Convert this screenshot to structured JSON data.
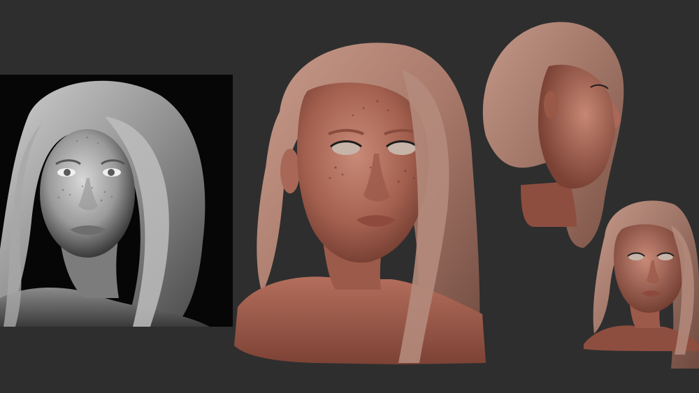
{
  "scene": {
    "background_color": "#2e2e2e",
    "reference_photo": {
      "kind": "black-and-white portrait photograph",
      "background_color": "#050505"
    },
    "sculpt_clay_color": "#a8685a",
    "views": [
      "front-three-quarter",
      "side-profile",
      "front-small"
    ]
  }
}
